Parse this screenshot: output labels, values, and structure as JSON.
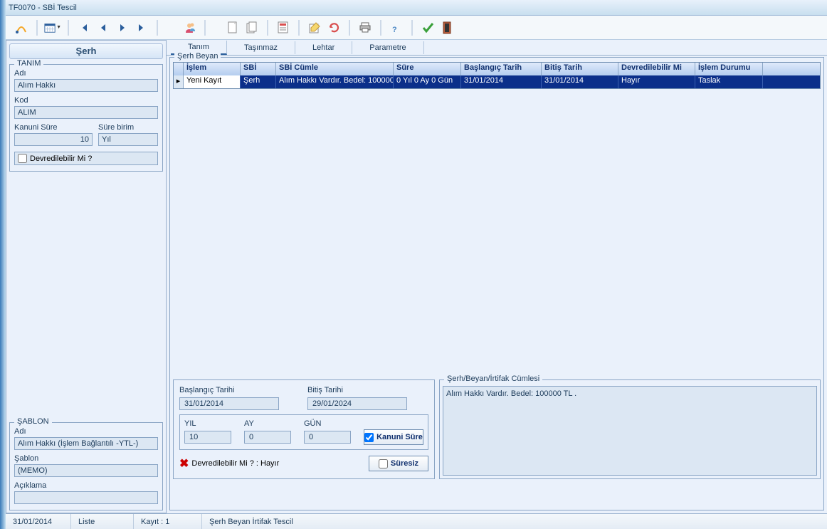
{
  "window": {
    "title": "TF0070 - SBİ Tescil"
  },
  "left": {
    "header": "Şerh",
    "tanim": {
      "title": "TANIM",
      "adi_label": "Adı",
      "adi": "Alım Hakkı",
      "kod_label": "Kod",
      "kod": "ALIM",
      "kanuni_sure_label": "Kanuni Süre",
      "kanuni_sure": "10",
      "sure_birim_label": "Süre birim",
      "sure_birim": "Yıl",
      "devredilebilir_label": "Devredilebilir Mi ?"
    },
    "sablon": {
      "title": "ŞABLON",
      "adi_label": "Adı",
      "adi": "Alım Hakkı (İşlem Bağlantılı -YTL-)",
      "sablon_label": "Şablon",
      "sablon": "(MEMO)",
      "aciklama_label": "Açıklama",
      "aciklama": ""
    }
  },
  "tabs": {
    "t1": "Tanım",
    "t2": "Taşınmaz",
    "t3": "Lehtar",
    "t4": "Parametre"
  },
  "grid": {
    "title": "Şerh Beyan",
    "headers": {
      "islem": "İşlem",
      "sbi": "SBİ",
      "cumle": "SBİ Cümle",
      "sure": "Süre",
      "bas": "Başlangıç Tarih",
      "bit": "Bitiş Tarih",
      "dev": "Devredilebilir Mi",
      "dur": "İşlem Durumu"
    },
    "row": {
      "islem": "Yeni Kayıt",
      "sbi": "Şerh",
      "cumle": "Alım Hakkı Vardır. Bedel:  100000",
      "sure": "0 Yıl 0 Ay 0 Gün",
      "bas": "31/01/2014",
      "bit": "31/01/2014",
      "dev": "Hayır",
      "dur": "Taslak"
    }
  },
  "bottom": {
    "bas_label": "Başlangıç Tarihi",
    "bas": "31/01/2014",
    "bit_label": "Bitiş Tarihi",
    "bit": "29/01/2024",
    "yil_label": "YIL",
    "yil": "10",
    "ay_label": "AY",
    "ay": "0",
    "gun_label": "GÜN",
    "gun": "0",
    "kanuni_btn": "Kanuni Süre",
    "dev_label": "Devredilebilir Mi ?    :",
    "dev_val": "Hayır",
    "suresiz_btn": "Süresiz",
    "cumle_title": "Şerh/Beyan/İrtifak Cümlesi",
    "cumle_val": "Alım Hakkı Vardır. Bedel:  100000 TL ."
  },
  "status": {
    "date": "31/01/2014",
    "liste": "Liste",
    "kayit": "Kayıt : 1",
    "desc": "Şerh Beyan İrtifak Tescil"
  }
}
